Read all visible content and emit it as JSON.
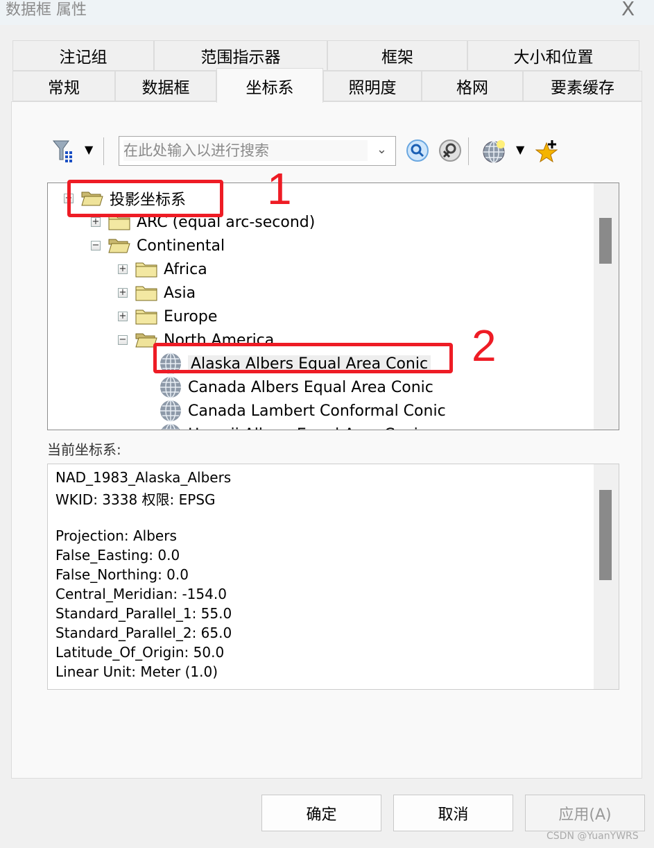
{
  "window": {
    "title": "数据框 属性",
    "close_label": "X"
  },
  "tabs": {
    "row1": [
      "注记组",
      "范围指示器",
      "框架",
      "大小和位置"
    ],
    "row2": [
      "常规",
      "数据框",
      "坐标系",
      "照明度",
      "格网",
      "要素缓存"
    ],
    "active": "坐标系"
  },
  "toolbar": {
    "search_placeholder": "在此处输入以进行搜索",
    "icons": [
      "filter-icon",
      "search-icon",
      "clear-search-icon",
      "globe-add-icon",
      "favorite-star-icon"
    ]
  },
  "tree": {
    "items": [
      {
        "label": "投影坐标系",
        "level": 0,
        "state": "expanded",
        "type": "folder"
      },
      {
        "label": "ARC (equal arc-second)",
        "level": 1,
        "state": "collapsed",
        "type": "folder"
      },
      {
        "label": "Continental",
        "level": 1,
        "state": "expanded",
        "type": "folder"
      },
      {
        "label": "Africa",
        "level": 2,
        "state": "collapsed",
        "type": "folder"
      },
      {
        "label": "Asia",
        "level": 2,
        "state": "collapsed",
        "type": "folder"
      },
      {
        "label": "Europe",
        "level": 2,
        "state": "collapsed",
        "type": "folder"
      },
      {
        "label": "North America",
        "level": 2,
        "state": "expanded",
        "type": "folder"
      },
      {
        "label": "Alaska Albers Equal Area Conic",
        "level": 3,
        "type": "crs",
        "selected": true
      },
      {
        "label": "Canada Albers Equal Area Conic",
        "level": 3,
        "type": "crs"
      },
      {
        "label": "Canada Lambert Conformal Conic",
        "level": 3,
        "type": "crs"
      },
      {
        "label": "Hawaii Albers Equal Area Conic",
        "level": 3,
        "type": "crs"
      }
    ]
  },
  "current": {
    "label": "当前坐标系:",
    "lines": [
      "NAD_1983_Alaska_Albers",
      "WKID: 3338 权限: EPSG",
      "",
      "Projection: Albers",
      "False_Easting: 0.0",
      "False_Northing: 0.0",
      "Central_Meridian: -154.0",
      "Standard_Parallel_1: 55.0",
      "Standard_Parallel_2: 65.0",
      "Latitude_Of_Origin: 50.0",
      "Linear Unit: Meter (1.0)"
    ]
  },
  "buttons": {
    "ok": "确定",
    "cancel": "取消",
    "apply": "应用(A)"
  },
  "annotations": {
    "callout1": "1",
    "callout2": "2",
    "color": "#ee1c25"
  },
  "watermark": "CSDN @YuanYWRS"
}
